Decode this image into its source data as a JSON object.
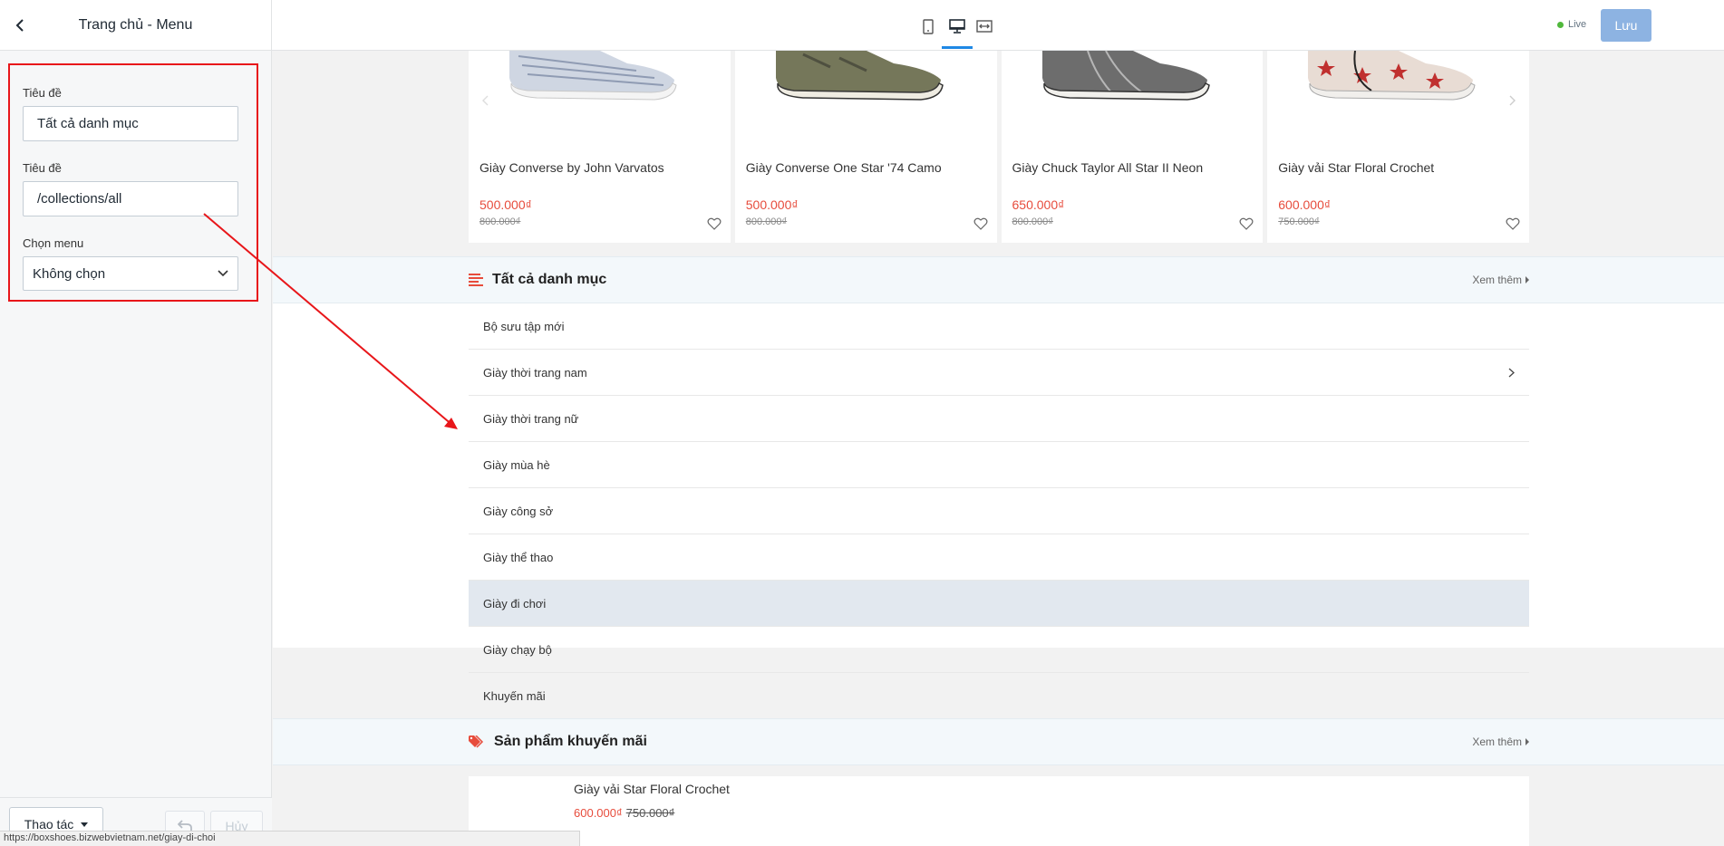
{
  "sidebar": {
    "title": "Trang chủ - Menu",
    "fields": [
      {
        "label": "Tiêu đề",
        "value": "Tất cả danh mục"
      },
      {
        "label": "Tiêu đề",
        "value": "/collections/all"
      }
    ],
    "menu_select": {
      "label": "Chọn menu",
      "value": "Không chọn"
    },
    "footer": {
      "actions_label": "Thao tác",
      "cancel_label": "Hủy"
    }
  },
  "topbar": {
    "devices": [
      "mobile-icon",
      "desktop-icon",
      "fullwidth-icon"
    ],
    "live_label": "Live",
    "save_label": "Lưu"
  },
  "products": [
    {
      "name": "Giày Converse by John Varvatos",
      "price": "500.000₫",
      "old_price": "800.000₫"
    },
    {
      "name": "Giày Converse One Star '74 Camo",
      "price": "500.000₫",
      "old_price": "800.000₫"
    },
    {
      "name": "Giày Chuck Taylor All Star II Neon",
      "price": "650.000₫",
      "old_price": "800.000₫"
    },
    {
      "name": "Giày vải Star Floral Crochet",
      "price": "600.000₫",
      "old_price": "750.000₫"
    }
  ],
  "categories_section": {
    "title": "Tất cả danh mục",
    "more_label": "Xem thêm",
    "items": [
      "Bộ sưu tập mới",
      "Giày thời trang nam",
      "Giày thời trang nữ",
      "Giày mùa hè",
      "Giày công sở",
      "Giày thể thao",
      "Giày đi chơi",
      "Giày chạy bộ",
      "Khuyến mãi"
    ],
    "active_item": "Giày đi chơi"
  },
  "promo_section": {
    "title": "Sản phẩm khuyến mãi",
    "more_label": "Xem thêm",
    "product": {
      "name": "Giày vải Star Floral Crochet",
      "price": "600.000₫",
      "old_price": "750.000₫"
    }
  },
  "status_url": "https://boxshoes.bizwebvietnam.net/giay-di-choi",
  "colors": {
    "annotation": "#e8161a",
    "price": "#e74c3c",
    "accent": "#1e88e5",
    "save_button": "#8db3e2",
    "live": "#50b83c"
  }
}
